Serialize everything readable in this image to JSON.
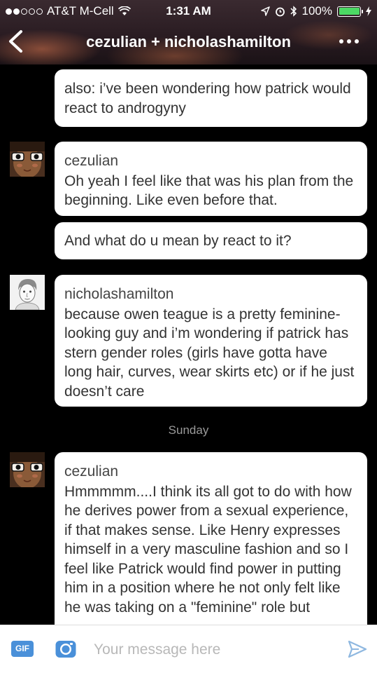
{
  "status_bar": {
    "carrier": "AT&T M-Cell",
    "time": "1:31 AM",
    "battery": "100%",
    "signal_bars": 2,
    "signal_total": 5
  },
  "nav": {
    "title": "cezulian + nicholashamilton"
  },
  "messages": [
    {
      "user": "",
      "text": "also: i’ve been wondering how patrick would react to androgyny"
    },
    {
      "user": "cezulian",
      "text": "Oh yeah I feel like that was his plan from the beginning. Like even before that."
    },
    {
      "user": "",
      "text": "And what do u mean by react to it?"
    },
    {
      "user": "nicholashamilton",
      "text": "because owen teague is a pretty feminine-looking guy and i’m wondering if patrick has stern gender roles (girls have gotta have long hair, curves, wear skirts etc) or if he just doesn’t care"
    },
    {
      "user": "cezulian",
      "text": "Hmmmmm....I think its all got to do with how he derives power from a sexual experience, if that makes sense. Like Henry expresses himself in a very masculine fashion and so I feel like Patrick would find power in putting him in a position where he not only felt like he was taking on a \"feminine\" role but"
    }
  ],
  "day_divider": "Sunday",
  "composer": {
    "gif_label": "GIF",
    "placeholder": "Your message here"
  },
  "colors": {
    "accent": "#4a90d9",
    "background": "#000000",
    "bubble": "#ffffff"
  }
}
